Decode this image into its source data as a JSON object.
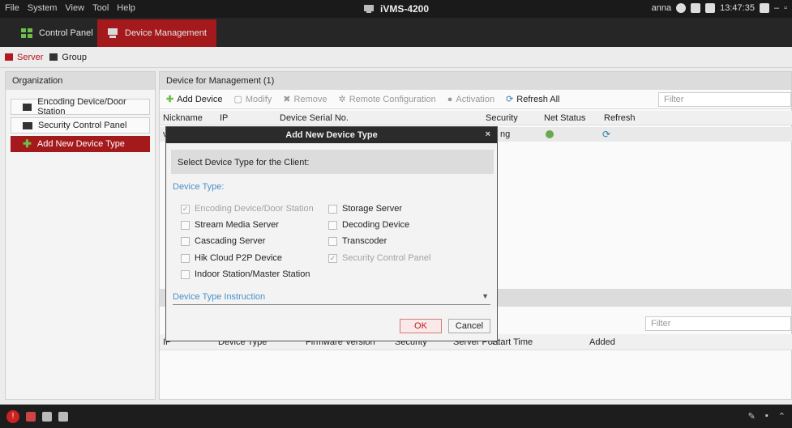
{
  "menu": [
    "File",
    "System",
    "View",
    "Tool",
    "Help"
  ],
  "app_title": "iVMS-4200",
  "tray": {
    "user": "anna",
    "time": "13:47:35"
  },
  "tabs": [
    {
      "label": "Control Panel"
    },
    {
      "label": "Device Management"
    }
  ],
  "subtabs": [
    {
      "label": "Server"
    },
    {
      "label": "Group"
    }
  ],
  "organization": {
    "header": "Organization",
    "items": [
      {
        "label": "Encoding Device/Door Station"
      },
      {
        "label": "Security Control Panel"
      },
      {
        "label": "Add New Device Type"
      }
    ]
  },
  "device_mgmt": {
    "header": "Device for Management (1)",
    "toolbar": {
      "add": "Add Device",
      "modify": "Modify",
      "remove": "Remove",
      "remote_config": "Remote Configuration",
      "activation": "Activation",
      "refresh_all": "Refresh All"
    },
    "filter_placeholder": "Filter",
    "columns": [
      "Nickname",
      "IP",
      "Device Serial No.",
      "Security",
      "Net Status",
      "Refresh"
    ],
    "row": {
      "nickname": "v",
      "security": "ng"
    }
  },
  "lower": {
    "filter_placeholder": "Filter",
    "columns": [
      "IP",
      "Device Type",
      "Firmware Version",
      "Security",
      "Server Port",
      "Start Time",
      "Added"
    ]
  },
  "dialog": {
    "title": "Add New Device Type",
    "close": "×",
    "prompt": "Select Device Type for the Client:",
    "device_type_label": "Device Type:",
    "options": [
      {
        "label": "Encoding Device/Door Station",
        "checked": true,
        "disabled": true
      },
      {
        "label": "Storage Server",
        "checked": false,
        "disabled": false
      },
      {
        "label": "Stream Media Server",
        "checked": false,
        "disabled": false
      },
      {
        "label": "Decoding Device",
        "checked": false,
        "disabled": false
      },
      {
        "label": "Cascading Server",
        "checked": false,
        "disabled": false
      },
      {
        "label": "Transcoder",
        "checked": false,
        "disabled": false
      },
      {
        "label": "Hik Cloud P2P Device",
        "checked": false,
        "disabled": false
      },
      {
        "label": "Security Control Panel",
        "checked": true,
        "disabled": true
      },
      {
        "label": "Indoor Station/Master Station",
        "checked": false,
        "disabled": false
      }
    ],
    "instruction": "Device Type Instruction",
    "ok": "OK",
    "cancel": "Cancel"
  }
}
